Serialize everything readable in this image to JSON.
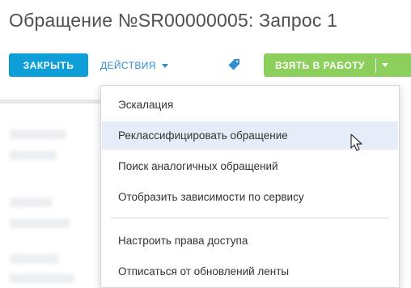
{
  "page": {
    "title": "Обращение №SR00000005: Запрос 1"
  },
  "toolbar": {
    "close_label": "ЗАКРЫТЬ",
    "actions_label": "ДЕЙСТВИЯ",
    "take_label": "ВЗЯТЬ В РАБОТУ",
    "icons": [
      "tag-icon",
      "chevron-down-icon"
    ]
  },
  "actions_menu": {
    "items": [
      {
        "label": "Эскалация"
      },
      {
        "label": "Реклассифицировать обращение"
      },
      {
        "label": "Поиск аналогичных обращений"
      },
      {
        "label": "Отобразить зависимости по сервису"
      },
      {
        "label": "Настроить права доступа"
      },
      {
        "label": "Отписаться от обновлений ленты"
      }
    ],
    "hovered_item": "Реклассифицировать обращение"
  },
  "colors": {
    "close_button": "#0e9fd9",
    "actions_link": "#2e8fd0",
    "take_button": "#8ccf5d",
    "menu_hover": "#e6ecf8",
    "title_text": "#505050"
  }
}
